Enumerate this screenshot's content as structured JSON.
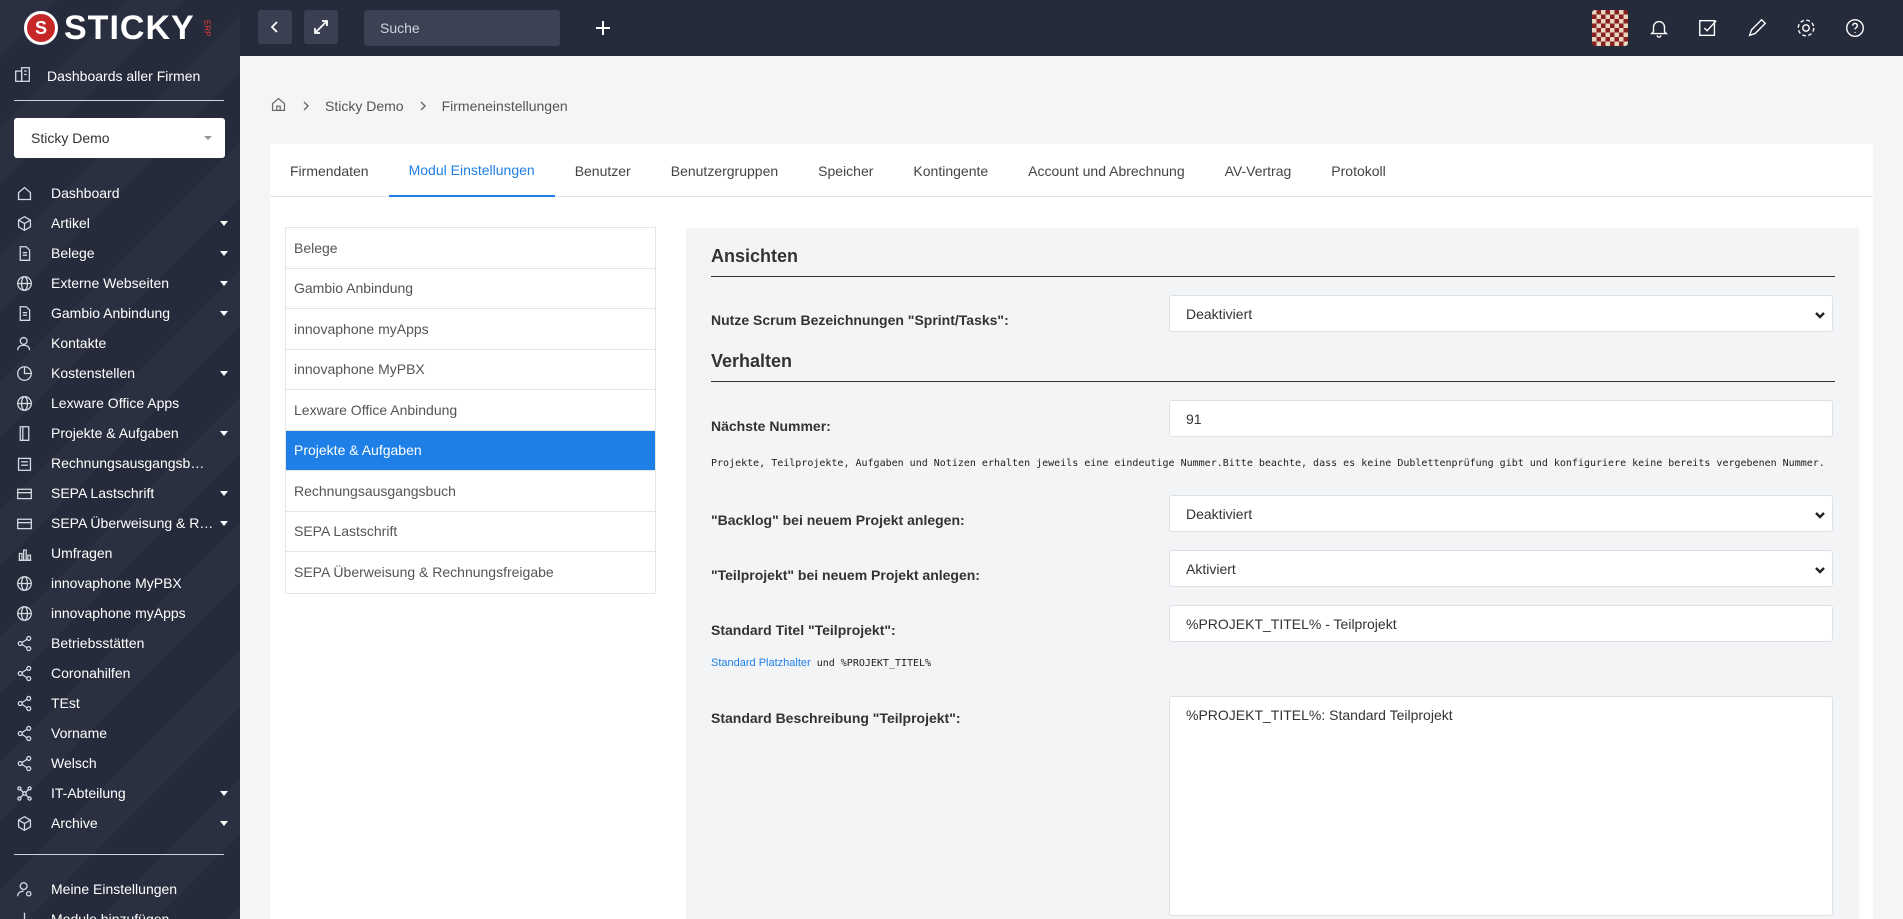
{
  "brand": {
    "name": "STICKY",
    "sub": "ERP"
  },
  "sidebar": {
    "dashboards_all": "Dashboards aller Firmen",
    "company": "Sticky Demo",
    "items": [
      {
        "label": "Dashboard",
        "icon": "home-icon",
        "arrow": false
      },
      {
        "label": "Artikel",
        "icon": "box-icon",
        "arrow": true
      },
      {
        "label": "Belege",
        "icon": "document-icon",
        "arrow": true
      },
      {
        "label": "Externe Webseiten",
        "icon": "globe-icon",
        "arrow": true
      },
      {
        "label": "Gambio Anbindung",
        "icon": "document-icon",
        "arrow": true
      },
      {
        "label": "Kontakte",
        "icon": "contacts-icon",
        "arrow": false
      },
      {
        "label": "Kostenstellen",
        "icon": "pie-chart-icon",
        "arrow": true
      },
      {
        "label": "Lexware Office Apps",
        "icon": "globe-icon",
        "arrow": false
      },
      {
        "label": "Projekte & Aufgaben",
        "icon": "book-icon",
        "arrow": true
      },
      {
        "label": "Rechnungsausgangsb…",
        "icon": "building-icon",
        "arrow": false
      },
      {
        "label": "SEPA Lastschrift",
        "icon": "card-icon",
        "arrow": true
      },
      {
        "label": "SEPA Überweisung & R…",
        "icon": "card-icon",
        "arrow": true
      },
      {
        "label": "Umfragen",
        "icon": "bar-chart-icon",
        "arrow": false
      },
      {
        "label": "innovaphone MyPBX",
        "icon": "globe-icon",
        "arrow": false
      },
      {
        "label": "innovaphone myApps",
        "icon": "globe-icon",
        "arrow": false
      },
      {
        "label": "Betriebsstätten",
        "icon": "share-icon",
        "arrow": false
      },
      {
        "label": "Coronahilfen",
        "icon": "share-icon",
        "arrow": false
      },
      {
        "label": "TEst",
        "icon": "share-icon",
        "arrow": false
      },
      {
        "label": "Vorname",
        "icon": "share-icon",
        "arrow": false
      },
      {
        "label": "Welsch",
        "icon": "share-icon",
        "arrow": false
      },
      {
        "label": "IT-Abteilung",
        "icon": "network-icon",
        "arrow": true
      },
      {
        "label": "Archive",
        "icon": "box-icon",
        "arrow": true
      }
    ],
    "my_settings": "Meine Einstellungen",
    "add_modules": "Module hinzufügen"
  },
  "topbar": {
    "search_placeholder": "Suche"
  },
  "breadcrumb": [
    "Sticky Demo",
    "Firmeneinstellungen"
  ],
  "tabs": [
    "Firmendaten",
    "Modul Einstellungen",
    "Benutzer",
    "Benutzergruppen",
    "Speicher",
    "Kontingente",
    "Account und Abrechnung",
    "AV-Vertrag",
    "Protokoll"
  ],
  "active_tab": 1,
  "modules": [
    "Belege",
    "Gambio Anbindung",
    "innovaphone myApps",
    "innovaphone MyPBX",
    "Lexware Office Anbindung",
    "Projekte & Aufgaben",
    "Rechnungsausgangsbuch",
    "SEPA Lastschrift",
    "SEPA Überweisung & Rechnungsfreigabe"
  ],
  "active_module": 5,
  "settings": {
    "views_title": "Ansichten",
    "scrum_label": "Nutze Scrum Bezeichnungen \"Sprint/Tasks\":",
    "scrum_value": "Deaktiviert",
    "behavior_title": "Verhalten",
    "next_number_label": "Nächste Nummer:",
    "next_number_value": "91",
    "next_number_help": "Projekte, Teilprojekte, Aufgaben und Notizen erhalten jeweils eine eindeutige Nummer.Bitte beachte, dass es keine Dublettenprüfung gibt und konfiguriere keine bereits vergebenen Nummer.",
    "backlog_label": "\"Backlog\" bei neuem Projekt anlegen:",
    "backlog_value": "Deaktiviert",
    "subproject_label": "\"Teilprojekt\" bei neuem Projekt anlegen:",
    "subproject_value": "Aktiviert",
    "std_title_label": "Standard Titel \"Teilprojekt\":",
    "std_title_value": "%PROJEKT_TITEL% - Teilprojekt",
    "placeholder_link": "Standard Platzhalter",
    "placeholder_rest": " und %PROJEKT_TITEL%",
    "std_desc_label": "Standard Beschreibung \"Teilprojekt\":",
    "std_desc_value": "%PROJEKT_TITEL%: Standard Teilprojekt"
  }
}
